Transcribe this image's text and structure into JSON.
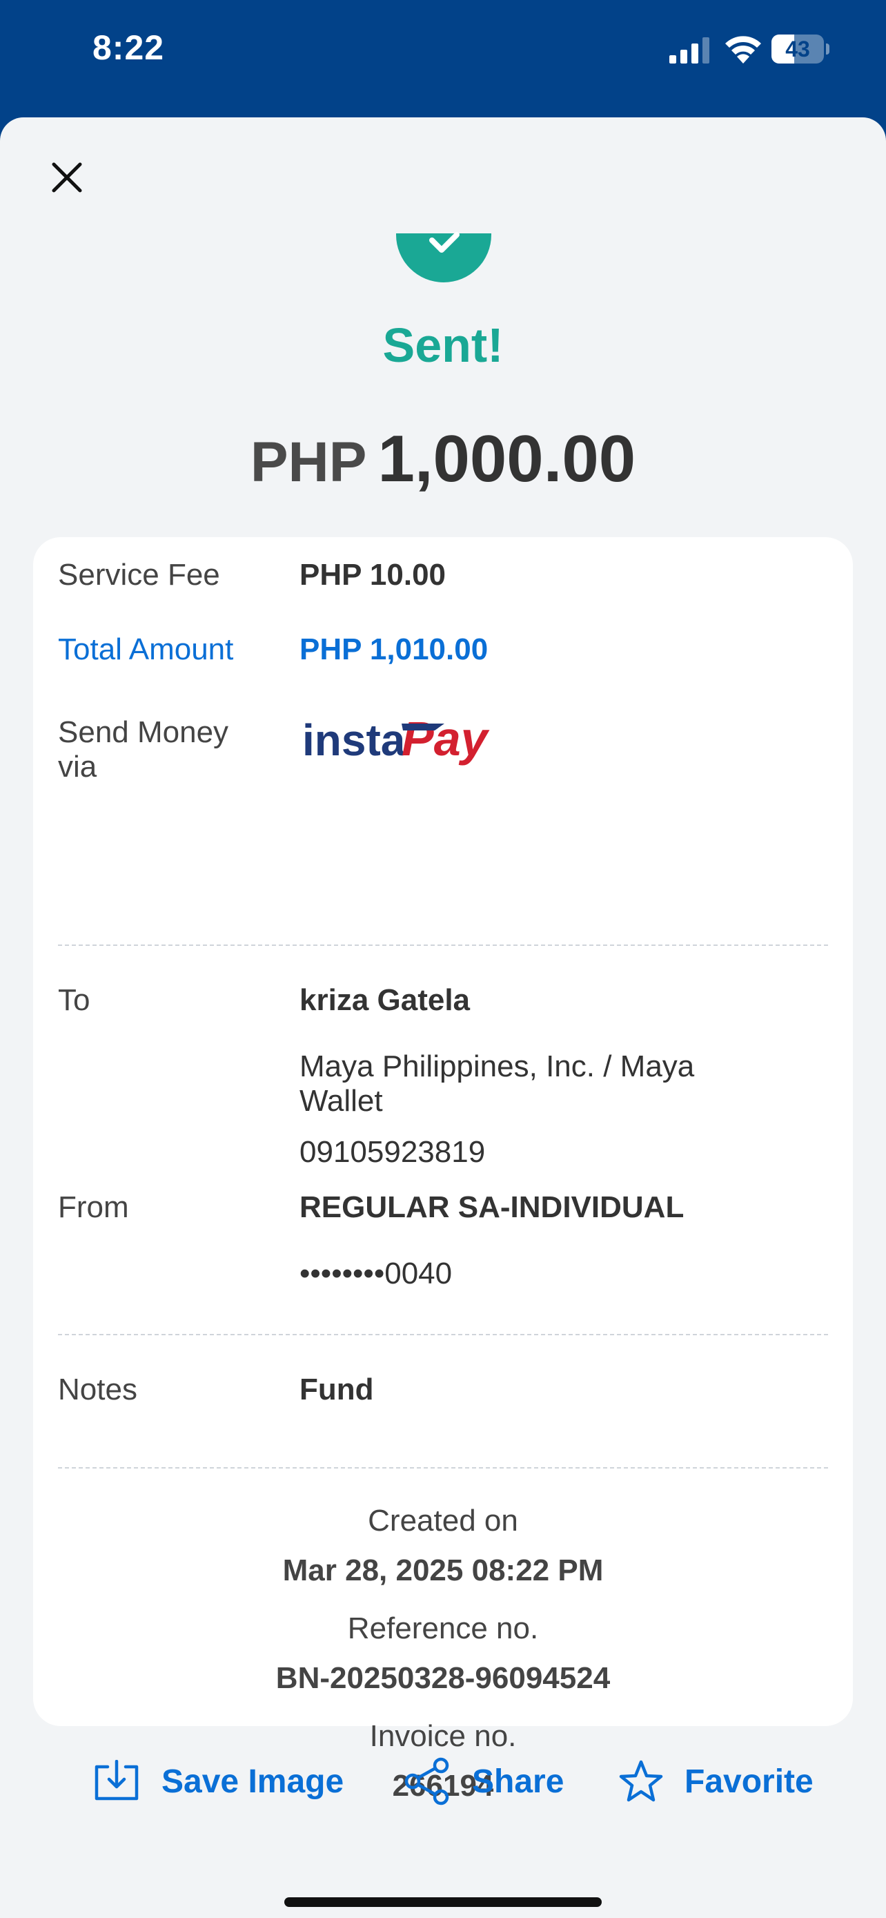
{
  "status_bar": {
    "time": "8:22",
    "battery_percent": 43,
    "battery_label": "43"
  },
  "header": {
    "close_icon": "close-icon",
    "success_icon": "checkmark-circle-icon",
    "title": "Sent!",
    "currency": "PHP",
    "amount": "1,000.00"
  },
  "details": {
    "service_fee_label": "Service Fee",
    "service_fee_value": "PHP 10.00",
    "total_label": "Total Amount",
    "total_value": "PHP 1,010.00",
    "send_via_label": "Send Money via",
    "send_via_logo_prefix": "insta",
    "send_via_logo_suffix": "Pay"
  },
  "recipient": {
    "to_label": "To",
    "name": "kriza Gatela",
    "bank": "Maya Philippines, Inc. / Maya Wallet",
    "account": "09105923819",
    "from_label": "From",
    "from_account_type": "REGULAR SA-INDIVIDUAL",
    "from_account_masked": "••••••••0040"
  },
  "notes": {
    "label": "Notes",
    "value": "Fund"
  },
  "meta": {
    "created_label": "Created on",
    "created_value": "Mar 28, 2025 08:22 PM",
    "reference_label": "Reference no.",
    "reference_value": "BN-20250328-96094524",
    "invoice_label": "Invoice no.",
    "invoice_value": "266194"
  },
  "actions": {
    "save_label": "Save Image",
    "share_label": "Share",
    "favorite_label": "Favorite"
  },
  "colors": {
    "brand_blue": "#024289",
    "accent_blue": "#0a6fd6",
    "success_green": "#1aa895",
    "instapay_navy": "#1f3a7a",
    "instapay_red": "#d3202f"
  }
}
